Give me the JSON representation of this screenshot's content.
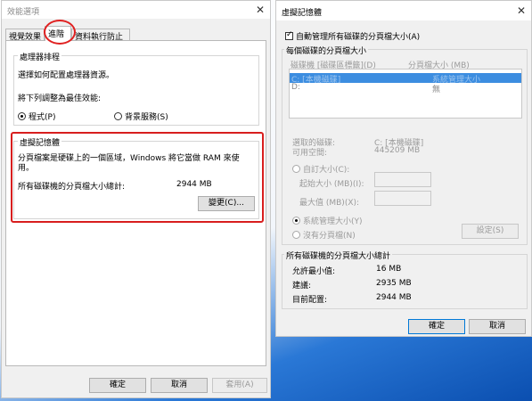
{
  "perf": {
    "title": "效能選項",
    "close": "✕",
    "tabs": [
      "視覺效果",
      "進階",
      "資料執行防止"
    ],
    "processor": {
      "title": "處理器排程",
      "desc": "選擇如何配置處理器資源。",
      "adjust": "將下列調整為最佳效能:",
      "opt_programs": "程式(P)",
      "opt_background": "背景服務(S)"
    },
    "vmem": {
      "title": "虛擬記憶體",
      "desc": "分頁檔案是硬碟上的一個區域，Windows 將它當做 RAM 來使用。",
      "total_label": "所有磁碟機的分頁檔大小總計:",
      "total_value": "2944 MB",
      "change_btn": "變更(C)..."
    },
    "buttons": {
      "ok": "確定",
      "cancel": "取消",
      "apply": "套用(A)"
    }
  },
  "vm": {
    "title": "虛擬記憶體",
    "close": "✕",
    "auto_manage": "自動管理所有磁碟的分頁檔大小(A)",
    "section_title": "每個磁碟的分頁檔大小",
    "col_drive": "磁碟機 [磁碟區標籤](D)",
    "col_size": "分頁檔大小 (MB)",
    "drives": [
      {
        "drive": "C:      [本機磁碟]",
        "size": "系統管理大小"
      },
      {
        "drive": "D:",
        "size": "無"
      }
    ],
    "selected_drive_label": "選取的磁碟:",
    "selected_drive_value": "C: [本機磁碟]",
    "free_label": "可用空間:",
    "free_value": "445209 MB",
    "custom_size": "自訂大小(C):",
    "initial_size": "起始大小 (MB)(I):",
    "max_size": "最大值 (MB)(X):",
    "system_managed": "系統管理大小(Y)",
    "no_paging": "沒有分頁檔(N)",
    "set_btn": "設定(S)",
    "total_section": "所有磁碟機的分頁檔大小總計",
    "min_label": "允許最小值:",
    "min_value": "16 MB",
    "rec_label": "建議:",
    "rec_value": "2935 MB",
    "cur_label": "目前配置:",
    "cur_value": "2944 MB",
    "ok": "確定",
    "cancel": "取消"
  },
  "colors": {
    "accent": "#0078d7",
    "highlight": "#e02020",
    "selection": "#3c8de0"
  }
}
